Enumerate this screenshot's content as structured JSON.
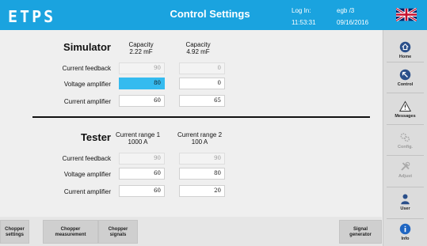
{
  "header": {
    "logo": "ETPS",
    "title": "Control Settings",
    "login_label": "Log In:",
    "login_user": "egb /3",
    "time": "11:53:31",
    "date": "09/16/2016"
  },
  "simulator": {
    "label": "Simulator",
    "col1_title": "Capacity",
    "col1_value": "2.22 mF",
    "col2_title": "Capacity",
    "col2_value": "4.92 mF",
    "rows": [
      {
        "label": "Current feedback",
        "v1": "90",
        "v2": "0"
      },
      {
        "label": "Voltage amplifier",
        "v1": "80",
        "v2": "0"
      },
      {
        "label": "Current amplifier",
        "v1": "60",
        "v2": "65"
      }
    ]
  },
  "tester": {
    "label": "Tester",
    "col1_title": "Current range 1",
    "col1_value": "1000 A",
    "col2_title": "Current range 2",
    "col2_value": "100 A",
    "rows": [
      {
        "label": "Current feedback",
        "v1": "90",
        "v2": "90"
      },
      {
        "label": "Voltage amplifier",
        "v1": "60",
        "v2": "80"
      },
      {
        "label": "Current amplifier",
        "v1": "60",
        "v2": "20"
      }
    ]
  },
  "bottom_buttons": {
    "chopper_settings_1": "Chopper",
    "chopper_settings_2": "settings",
    "chopper_measurement_1": "Chopper",
    "chopper_measurement_2": "measurement",
    "chopper_signals_1": "Chopper",
    "chopper_signals_2": "signals",
    "signal_generator_1": "Signal",
    "signal_generator_2": "generator"
  },
  "sidebar": {
    "home": "Home",
    "control": "Control",
    "messages": "Messages",
    "config": "Config.",
    "adjust": "Adjust",
    "user": "User",
    "info": "Info"
  },
  "icons": {
    "home": "home-icon",
    "control": "control-icon",
    "messages": "warning-icon",
    "config": "gears-icon",
    "adjust": "tools-icon",
    "user": "user-icon",
    "info": "info-icon",
    "flag": "uk-flag-icon"
  },
  "colors": {
    "header": "#1aa3df",
    "selected_field": "#35bbef"
  }
}
